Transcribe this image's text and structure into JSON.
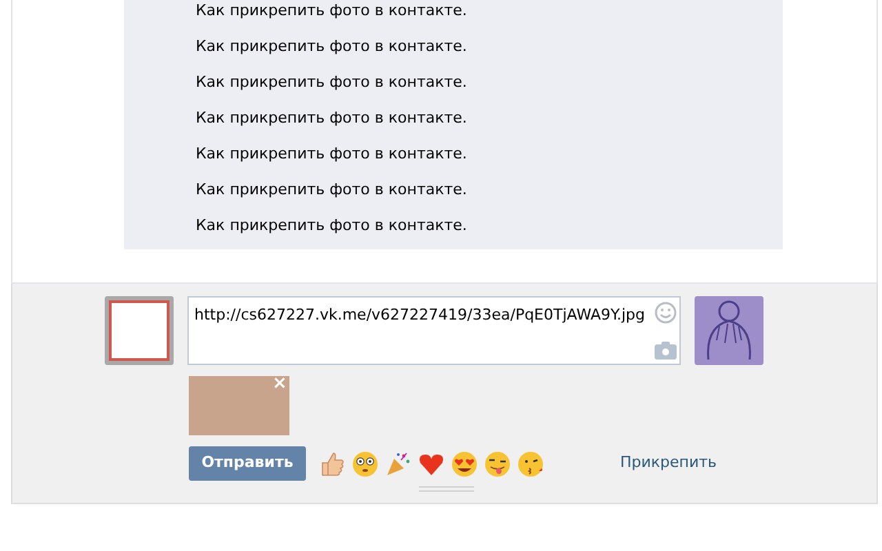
{
  "post": {
    "lines": [
      "Как прикрепить фото в контакте.",
      "Как прикрепить фото в контакте.",
      "Как прикрепить фото в контакте.",
      "Как прикрепить фото в контакте.",
      "Как прикрепить фото в контакте.",
      "Как прикрепить фото в контакте.",
      "Как прикрепить фото в контакте."
    ]
  },
  "composer": {
    "value": "http://cs627227.vk.me/v627227419/33ea/PqE0TjAWA9Y.jpg",
    "attachment_close": "×",
    "send_button": "Отправить",
    "attach_link": "Прикрепить"
  }
}
